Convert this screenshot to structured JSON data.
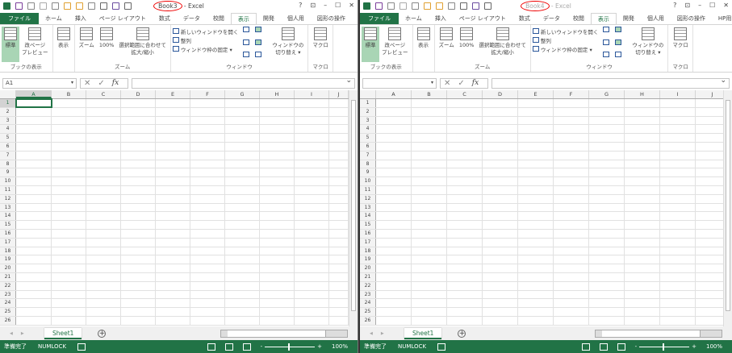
{
  "windows": [
    {
      "side": "left",
      "title_book": "Book3",
      "title_sep": " - ",
      "title_app": "Excel",
      "name_box": "A1",
      "active_cell": true
    },
    {
      "side": "right",
      "title_book": "Book4",
      "title_sep": " - ",
      "title_app": "Excel",
      "name_box": "",
      "active_cell": false
    }
  ],
  "window_controls": [
    "?",
    "⊡",
    "–",
    "☐",
    "✕"
  ],
  "tabs": [
    "ファイル",
    "ホーム",
    "挿入",
    "ページ レイアウト",
    "数式",
    "データ",
    "校閲",
    "表示",
    "開発",
    "個人用",
    "図形の操作",
    "HP用の"
  ],
  "active_tab": "表示",
  "ribbon": {
    "book_view": {
      "label": "ブックの表示",
      "normal": "標準",
      "page_break": "改ページ\nプレビュー"
    },
    "show": {
      "label": "表示"
    },
    "zoom": {
      "label": "ズーム",
      "zoom": "ズーム",
      "hundred": "100%",
      "fit": "選択範囲に合わせて\n拡大/縮小"
    },
    "window": {
      "label": "ウィンドウ",
      "new_window": "新しいウィンドウを開く",
      "arrange": "整列",
      "freeze": "ウィンドウ枠の固定 ▾",
      "switch": "ウィンドウの\n切り替え ▾"
    },
    "macro": {
      "label": "マクロ",
      "macro": "マクロ"
    }
  },
  "formula": {
    "cancel": "✕",
    "enter": "✓",
    "fx": "fx"
  },
  "columns": [
    "A",
    "B",
    "C",
    "D",
    "E",
    "F",
    "G",
    "H",
    "I",
    "J"
  ],
  "rows": [
    "1",
    "2",
    "3",
    "4",
    "5",
    "6",
    "7",
    "8",
    "9",
    "10",
    "11",
    "12",
    "13",
    "14",
    "15",
    "16",
    "17",
    "18",
    "19",
    "20",
    "21",
    "22",
    "23",
    "24",
    "25",
    "26"
  ],
  "sheet_tab": "Sheet1",
  "status": {
    "ready": "準備完了",
    "numlock": "NUMLOCK",
    "zoom": "100%",
    "zoom_minus": "-",
    "zoom_plus": "+"
  },
  "colors": {
    "excel_green": "#217346"
  }
}
